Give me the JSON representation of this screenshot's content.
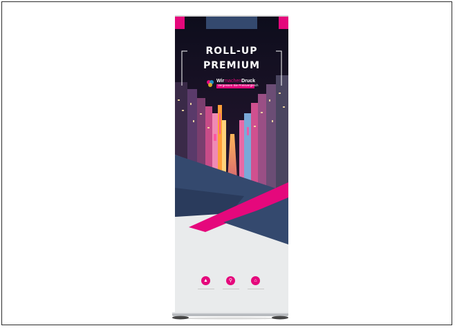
{
  "banner": {
    "title_line1": "ROLL-UP",
    "title_line2": "PREMIUM",
    "logo_part1": "Wir",
    "logo_part2": "machen",
    "logo_part3": "Druck",
    "logo_tagline": "Vergessen Sie Preisvergleich",
    "icons": [
      "user-icon",
      "search-icon",
      "home-icon"
    ],
    "colors": {
      "accent": "#e5087c",
      "navy": "#34496e",
      "light": "#e9ebec"
    }
  }
}
